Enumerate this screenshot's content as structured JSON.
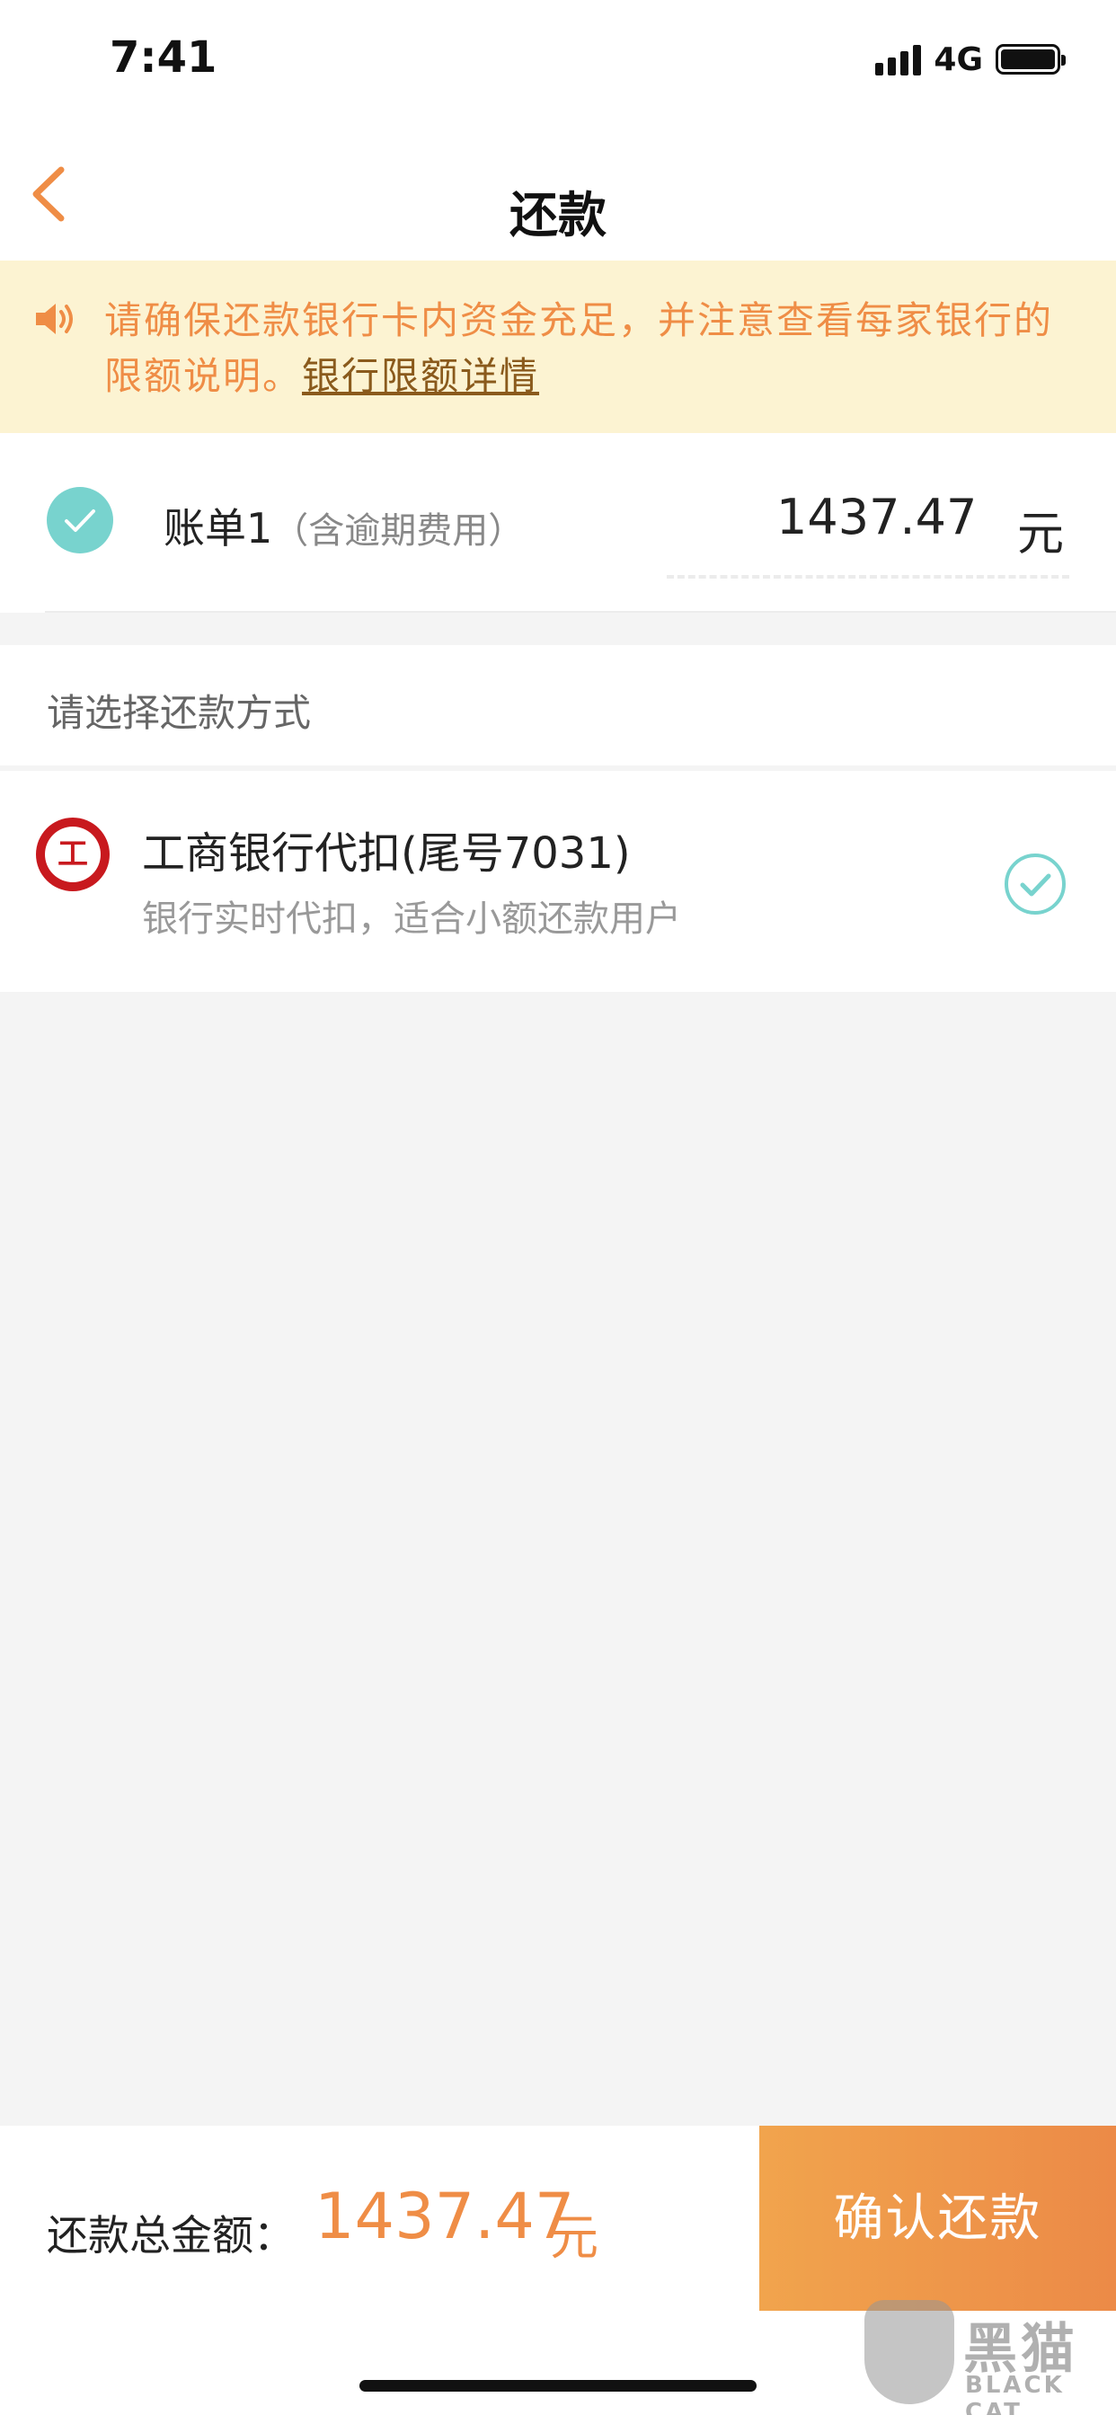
{
  "status_bar": {
    "time": "7:41",
    "network": "4G",
    "battery_level": 1.0
  },
  "nav": {
    "title": "还款",
    "back_icon": "chevron-left-icon"
  },
  "notice": {
    "icon": "speaker-icon",
    "text": "请确保还款银行卡内资金充足，并注意查看每家银行的限额说明。",
    "link": "银行限额详情"
  },
  "bill": {
    "checked": true,
    "title": "账单1",
    "subtitle": "（含逾期费用）",
    "amount": "1437.47",
    "unit": "元"
  },
  "payment_section": {
    "title": "请选择还款方式",
    "methods": [
      {
        "name": "工商银行代扣(尾号7031)",
        "description": "银行实时代扣，适合小额还款用户",
        "logo_glyph": "工",
        "selected": true
      }
    ]
  },
  "footer": {
    "total_label": "还款总金额：",
    "total_amount": "1437.47",
    "total_unit": "元",
    "confirm_label": "确认还款"
  },
  "watermark": {
    "text": "黑猫",
    "sub": "BLACK CAT"
  },
  "colors": {
    "accent": "#ef8d46",
    "notice_bg": "#fcf3d2",
    "check_teal": "#78d3ce",
    "bank_red": "#c8191e"
  }
}
